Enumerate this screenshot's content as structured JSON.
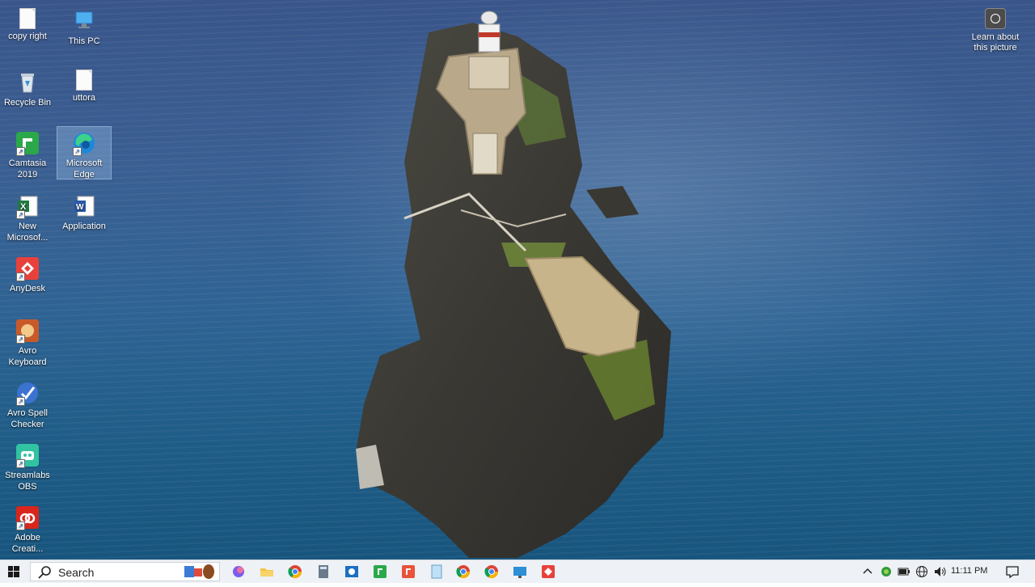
{
  "desktop_icons": [
    {
      "name": "copy-right",
      "label": "copy right",
      "type": "text-file"
    },
    {
      "name": "this-pc",
      "label": "This PC",
      "type": "pc"
    },
    {
      "name": "recycle-bin",
      "label": "Recycle Bin",
      "type": "bin"
    },
    {
      "name": "uttora",
      "label": "uttora",
      "type": "text-file"
    },
    {
      "name": "camtasia",
      "label": "Camtasia 2019",
      "type": "app",
      "color": "#2aa84a"
    },
    {
      "name": "microsoft-edge",
      "label": "Microsoft Edge",
      "type": "app",
      "color": "#1e88d8"
    },
    {
      "name": "new-excel",
      "label": "New Microsof...",
      "type": "excel",
      "color": "#1f7a43"
    },
    {
      "name": "application",
      "label": "Application",
      "type": "word",
      "color": "#2a5ba8"
    },
    {
      "name": "anydesk",
      "label": "AnyDesk",
      "type": "app",
      "color": "#e8413c"
    },
    {
      "name": "avro-keyboard",
      "label": "Avro Keyboard",
      "type": "app",
      "color": "#c85a2a"
    },
    {
      "name": "avro-spell-checker",
      "label": "Avro Spell Checker",
      "type": "app",
      "color": "#3b73d1"
    },
    {
      "name": "streamlabs-obs",
      "label": "Streamlabs OBS",
      "type": "app",
      "color": "#31c3a2"
    },
    {
      "name": "adobe-creative",
      "label": "Adobe Creati...",
      "type": "app",
      "color": "#d9261c"
    }
  ],
  "learn_about": "Learn about this picture",
  "taskbar": {
    "search_placeholder": "Search",
    "clock": "11:11 PM"
  },
  "colors": {
    "taskbar_bg": "#eef1f5",
    "water": "#2f6394"
  }
}
